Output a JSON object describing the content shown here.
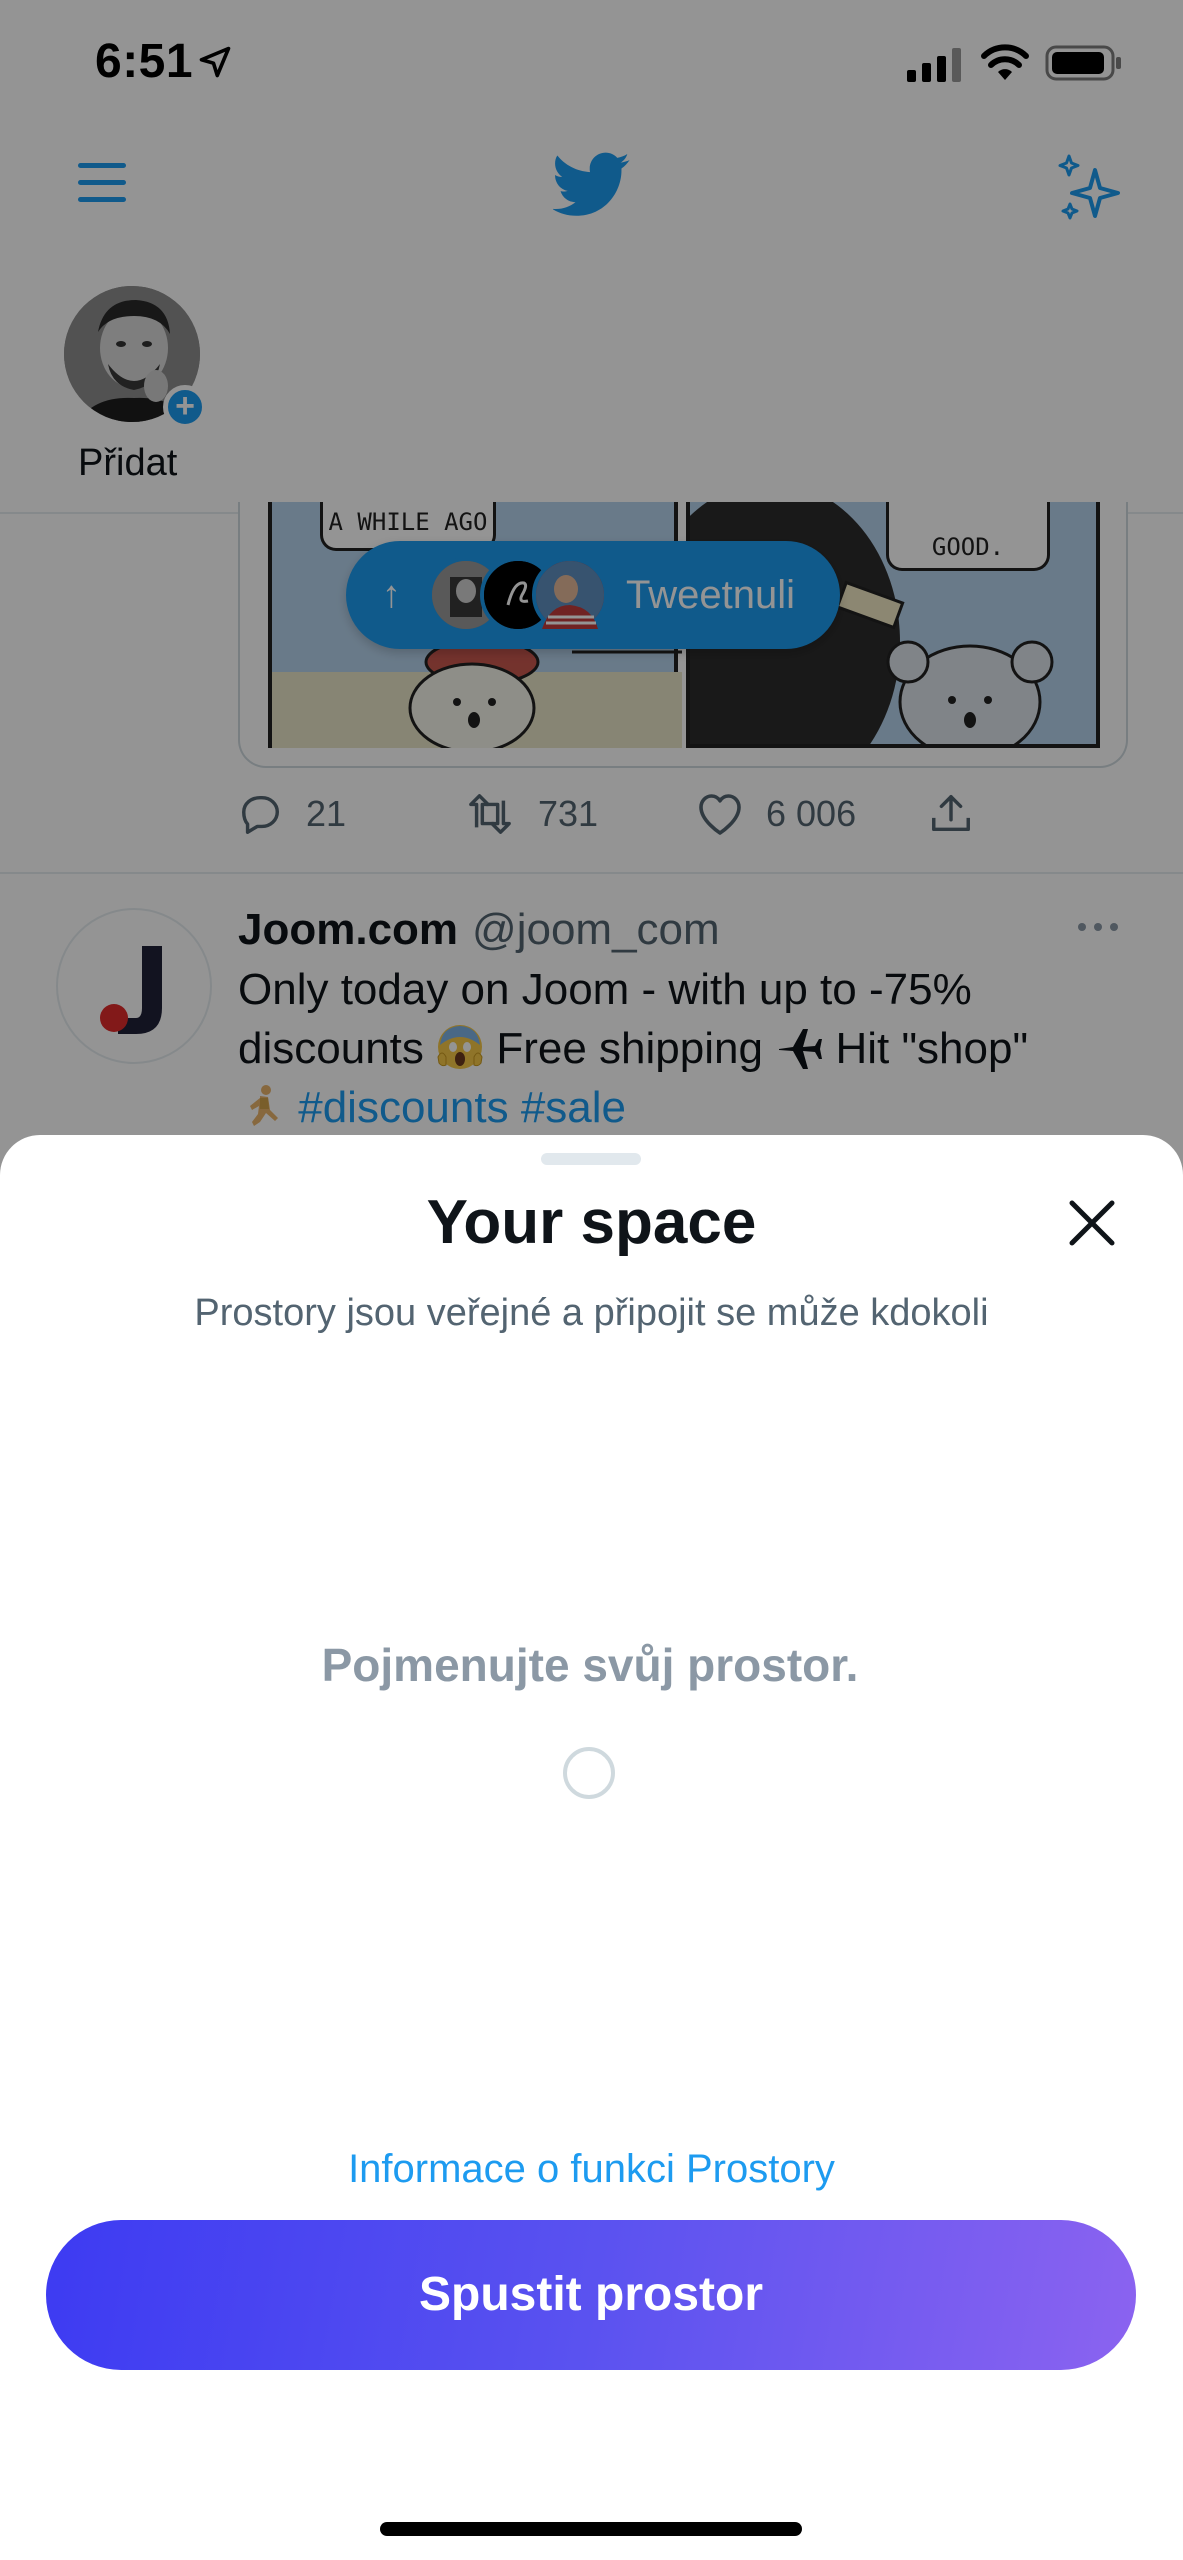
{
  "status_bar": {
    "time": "6:51"
  },
  "fleets": {
    "add_label": "Přidat"
  },
  "tweet_1": {
    "comic_text_left": "A WHILE AGO",
    "comic_text_right": "GOOD.",
    "tweeted_label": "Tweetnuli",
    "reply_count": "21",
    "retweet_count": "731",
    "like_count": "6 006"
  },
  "tweet_2": {
    "name": "Joom.com",
    "handle": "@joom_com",
    "text_part_1": "Only today on Joom - with up to -75% discounts",
    "text_part_2": "Free shipping",
    "text_part_3": "Hit \"shop\"",
    "hashtags": "#discounts #sale"
  },
  "sheet": {
    "title": "Your space",
    "subtitle": "Prostory jsou veřejné a připojit se může kdokoli",
    "name_placeholder": "Pojmenujte svůj prostor.",
    "info_link": "Informace o funkci Prostory",
    "start_button": "Spustit prostor"
  },
  "colors": {
    "twitter_blue": "#1d9bf0",
    "button_gradient_start": "#3d3bf2",
    "button_gradient_end": "#8b63f0"
  }
}
